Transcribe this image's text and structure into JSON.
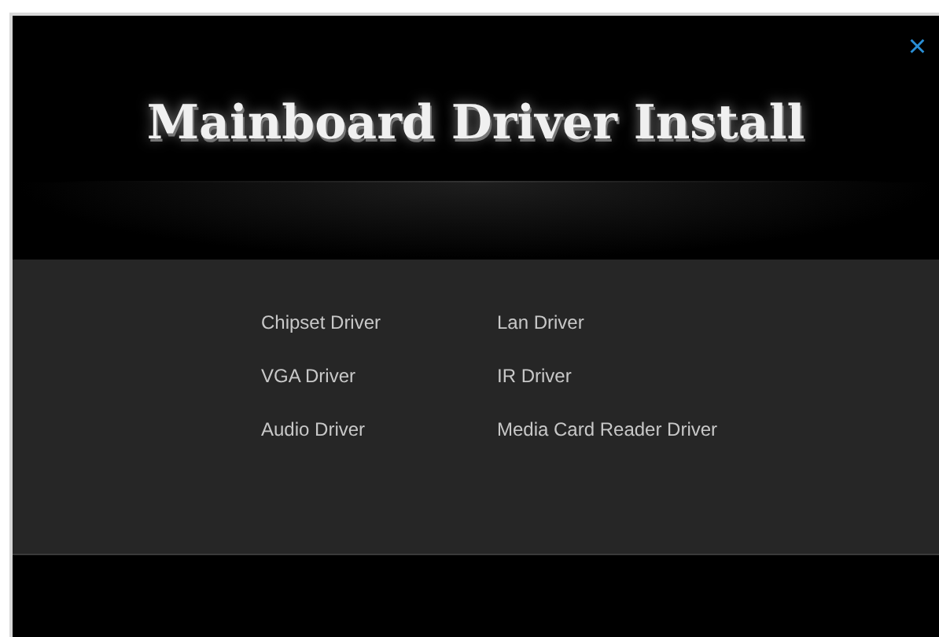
{
  "window": {
    "title": "Mainboard Driver Install",
    "close": "×"
  },
  "drivers": [
    {
      "label": "Chipset Driver"
    },
    {
      "label": "Lan Driver"
    },
    {
      "label": "VGA Driver"
    },
    {
      "label": "IR Driver"
    },
    {
      "label": "Audio Driver"
    },
    {
      "label": "Media Card Reader Driver"
    }
  ]
}
